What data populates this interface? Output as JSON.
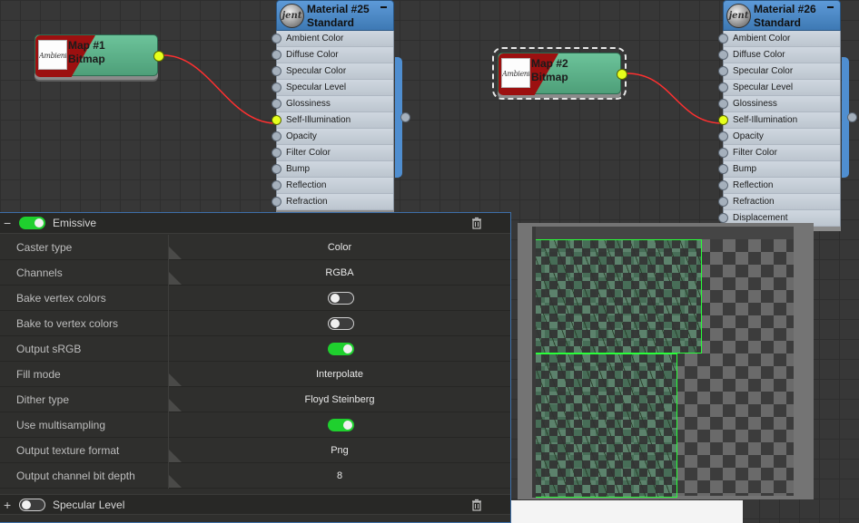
{
  "nodes": {
    "map1": {
      "title_line1": "Map #1",
      "title_line2": "Bitmap",
      "thumb_text": "AmbientColor"
    },
    "map2": {
      "title_line1": "Map #2",
      "title_line2": "Bitmap",
      "thumb_text": "AmbientColor"
    },
    "material25": {
      "title_line1": "Material #25",
      "title_line2": "Standard",
      "sphere_text": "jent",
      "slots": [
        "Ambient Color",
        "Diffuse Color",
        "Specular Color",
        "Specular Level",
        "Glossiness",
        "Self-Illumination",
        "Opacity",
        "Filter Color",
        "Bump",
        "Reflection",
        "Refraction"
      ],
      "connected_slot": "Self-Illumination"
    },
    "material26": {
      "title_line1": "Material #26",
      "title_line2": "Standard",
      "sphere_text": "jent",
      "slots": [
        "Ambient Color",
        "Diffuse Color",
        "Specular Color",
        "Specular Level",
        "Glossiness",
        "Self-Illumination",
        "Opacity",
        "Filter Color",
        "Bump",
        "Reflection",
        "Refraction",
        "Displacement"
      ],
      "connected_slot": "Self-Illumination"
    }
  },
  "panel": {
    "emissive": {
      "expand_symbol": "−",
      "label": "Emissive",
      "enabled": true,
      "properties": [
        {
          "label": "Caster type",
          "value": "Color"
        },
        {
          "label": "Channels",
          "value": "RGBA"
        },
        {
          "label": "Bake vertex colors",
          "toggle": false
        },
        {
          "label": "Bake to vertex colors",
          "toggle": false
        },
        {
          "label": "Output sRGB",
          "toggle": true
        },
        {
          "label": "Fill mode",
          "value": "Interpolate"
        },
        {
          "label": "Dither type",
          "value": "Floyd Steinberg"
        },
        {
          "label": "Use multisampling",
          "toggle": true
        },
        {
          "label": "Output texture format",
          "value": "Png"
        },
        {
          "label": "Output channel bit depth",
          "value": "8"
        }
      ]
    },
    "specular": {
      "expand_symbol": "+",
      "label": "Specular Level",
      "enabled": false
    }
  },
  "colors": {
    "accent_green": "#1fd02e",
    "wire": "#ff3030",
    "socket_active": "#e6ff1c",
    "uv_outline": "#2aff3a"
  }
}
